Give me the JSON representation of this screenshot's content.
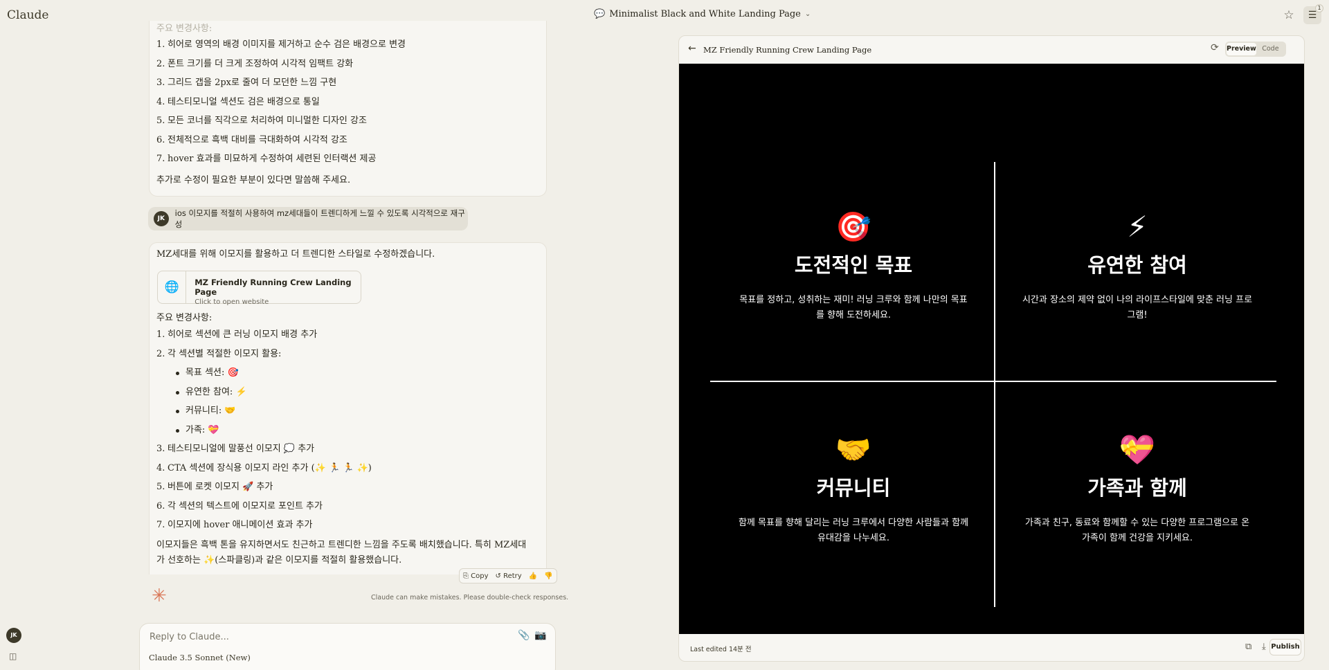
{
  "app": {
    "brand": "Claude"
  },
  "header": {
    "conversation_title": "Minimalist Black and White Landing Page",
    "chat_icon": "chat-bubble-icon",
    "chevron": "⌄",
    "star_icon": "☆",
    "tune_icon": "☰",
    "tune_badge": "1"
  },
  "prev_message": {
    "heading": "주요 변경사항:",
    "items": [
      {
        "n": "1.",
        "text": "히어로 영역의 배경 이미지를 제거하고 순수 검은 배경으로 변경"
      },
      {
        "n": "2.",
        "text": "폰트 크기를 더 크게 조정하여 시각적 임팩트 강화"
      },
      {
        "n": "3.",
        "text": "그리드 갭을 2px로 줄여 더 모던한 느낌 구현"
      },
      {
        "n": "4.",
        "text": "테스티모니얼 섹션도 검은 배경으로 통일"
      },
      {
        "n": "5.",
        "text": "모든 코너를 직각으로 처리하여 미니멀한 디자인 강조"
      },
      {
        "n": "6.",
        "text": "전체적으로 흑백 대비를 극대화하여 시각적 강조"
      },
      {
        "n": "7.",
        "text": "hover 효과를 미묘하게 수정하여 세련된 인터랙션 제공"
      }
    ],
    "closing": "추가로 수정이 필요한 부분이 있다면 말씀해 주세요."
  },
  "user_message": {
    "avatar": "JK",
    "text": "ios 이모지를 적절히 사용하여 mz세대들이 트렌디하게 느낄 수 있도록 시각적으로 재구성"
  },
  "assistant_message": {
    "intro": "MZ세대를 위해 이모지를 활용하고 더 트렌디한 스타일로 수정하겠습니다.",
    "artifact": {
      "icon": "🌐",
      "title": "MZ Friendly Running Crew Landing Page",
      "subtitle": "Click to open website"
    },
    "heading": "주요 변경사항:",
    "item1": {
      "n": "1.",
      "text": "히어로 섹션에 큰 러닝 이모지 배경 추가"
    },
    "item2": {
      "n": "2.",
      "text": "각 섹션별 적절한 이모지 활용:"
    },
    "bullets": [
      "목표 섹션: 🎯",
      "유연한 참여: ⚡",
      "커뮤니티: 🤝",
      "가족: 💝"
    ],
    "items_rest": [
      {
        "n": "3.",
        "text": "테스티모니얼에 말풍선 이모지 💭 추가"
      },
      {
        "n": "4.",
        "text": "CTA 섹션에 장식용 이모지 라인 추가 (✨ 🏃 🏃 ✨)"
      },
      {
        "n": "5.",
        "text": "버튼에 로켓 이모지 🚀 추가"
      },
      {
        "n": "6.",
        "text": "각 섹션의 텍스트에 이모지로 포인트 추가"
      },
      {
        "n": "7.",
        "text": "이모지에 hover 애니메이션 효과 추가"
      }
    ],
    "closing": "이모지들은 흑백 톤을 유지하면서도 친근하고 트렌디한 느낌을 주도록 배치했습니다. 특히 MZ세대가 선호하는 ✨(스파클링)과 같은 이모지를 적절히 활용했습니다."
  },
  "message_actions": {
    "copy": "⎘ Copy",
    "retry": "↺ Retry",
    "thumbs_up": "👍",
    "thumbs_down": "👎"
  },
  "assistant_mark": "✳",
  "disclaimer": "Claude can make mistakes. Please double-check responses.",
  "reply": {
    "placeholder": "Reply to Claude...",
    "attach_icon": "📎",
    "camera_icon": "📷",
    "model": "Claude 3.5 Sonnet (New)"
  },
  "sidebar": {
    "avatar": "JK",
    "toggle_icon": "◫"
  },
  "panel": {
    "back_icon": "←",
    "title": "MZ Friendly Running Crew Landing Page",
    "refresh_icon": "⟳",
    "tabs": {
      "preview": "Preview",
      "code": "Code"
    },
    "close_icon": "✕",
    "features": [
      {
        "emoji": "🎯",
        "title": "도전적인 목표",
        "desc": "목표를 정하고, 성취하는 재미! 러닝 크루와 함께 나만의 목표를 향해 도전하세요."
      },
      {
        "emoji": "⚡",
        "title": "유연한 참여",
        "desc": "시간과 장소의 제약 없이 나의 라이프스타일에 맞춘 러닝 프로그램!"
      },
      {
        "emoji": "🤝",
        "title": "커뮤니티",
        "desc": "함께 목표를 향해 달리는 러닝 크루에서 다양한 사람들과 함께 유대감을 나누세요."
      },
      {
        "emoji": "💝",
        "title": "가족과 함께",
        "desc": "가족과 친구, 동료와 함께할 수 있는 다양한 프로그램으로 온 가족이 함께 건강을 지키세요."
      }
    ],
    "footer": {
      "last_edited": "Last edited 14분 전",
      "copy_icon": "⧉",
      "download_icon": "⤓",
      "publish": "Publish"
    }
  }
}
